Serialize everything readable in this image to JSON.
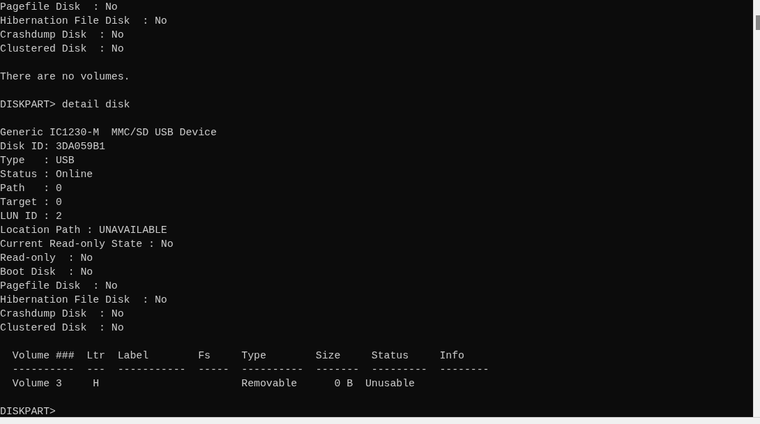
{
  "console": {
    "blocks": [
      {
        "lines": [
          "Pagefile Disk  : No",
          "Hibernation File Disk  : No",
          "Crashdump Disk  : No",
          "Clustered Disk  : No"
        ]
      },
      {
        "lines": [
          "There are no volumes."
        ]
      },
      {
        "lines": [
          "DISKPART> detail disk"
        ]
      },
      {
        "lines": [
          "Generic IC1230-M  MMC/SD USB Device",
          "Disk ID: 3DA059B1",
          "Type   : USB",
          "Status : Online",
          "Path   : 0",
          "Target : 0",
          "LUN ID : 2",
          "Location Path : UNAVAILABLE",
          "Current Read-only State : No",
          "Read-only  : No",
          "Boot Disk  : No",
          "Pagefile Disk  : No",
          "Hibernation File Disk  : No",
          "Crashdump Disk  : No",
          "Clustered Disk  : No"
        ]
      },
      {
        "lines": [
          "  Volume ###  Ltr  Label        Fs     Type        Size     Status     Info",
          "  ----------  ---  -----------  -----  ----------  -------  ---------  --------",
          "  Volume 3     H                       Removable      0 B  Unusable"
        ]
      },
      {
        "lines": [
          "DISKPART>"
        ]
      }
    ]
  }
}
